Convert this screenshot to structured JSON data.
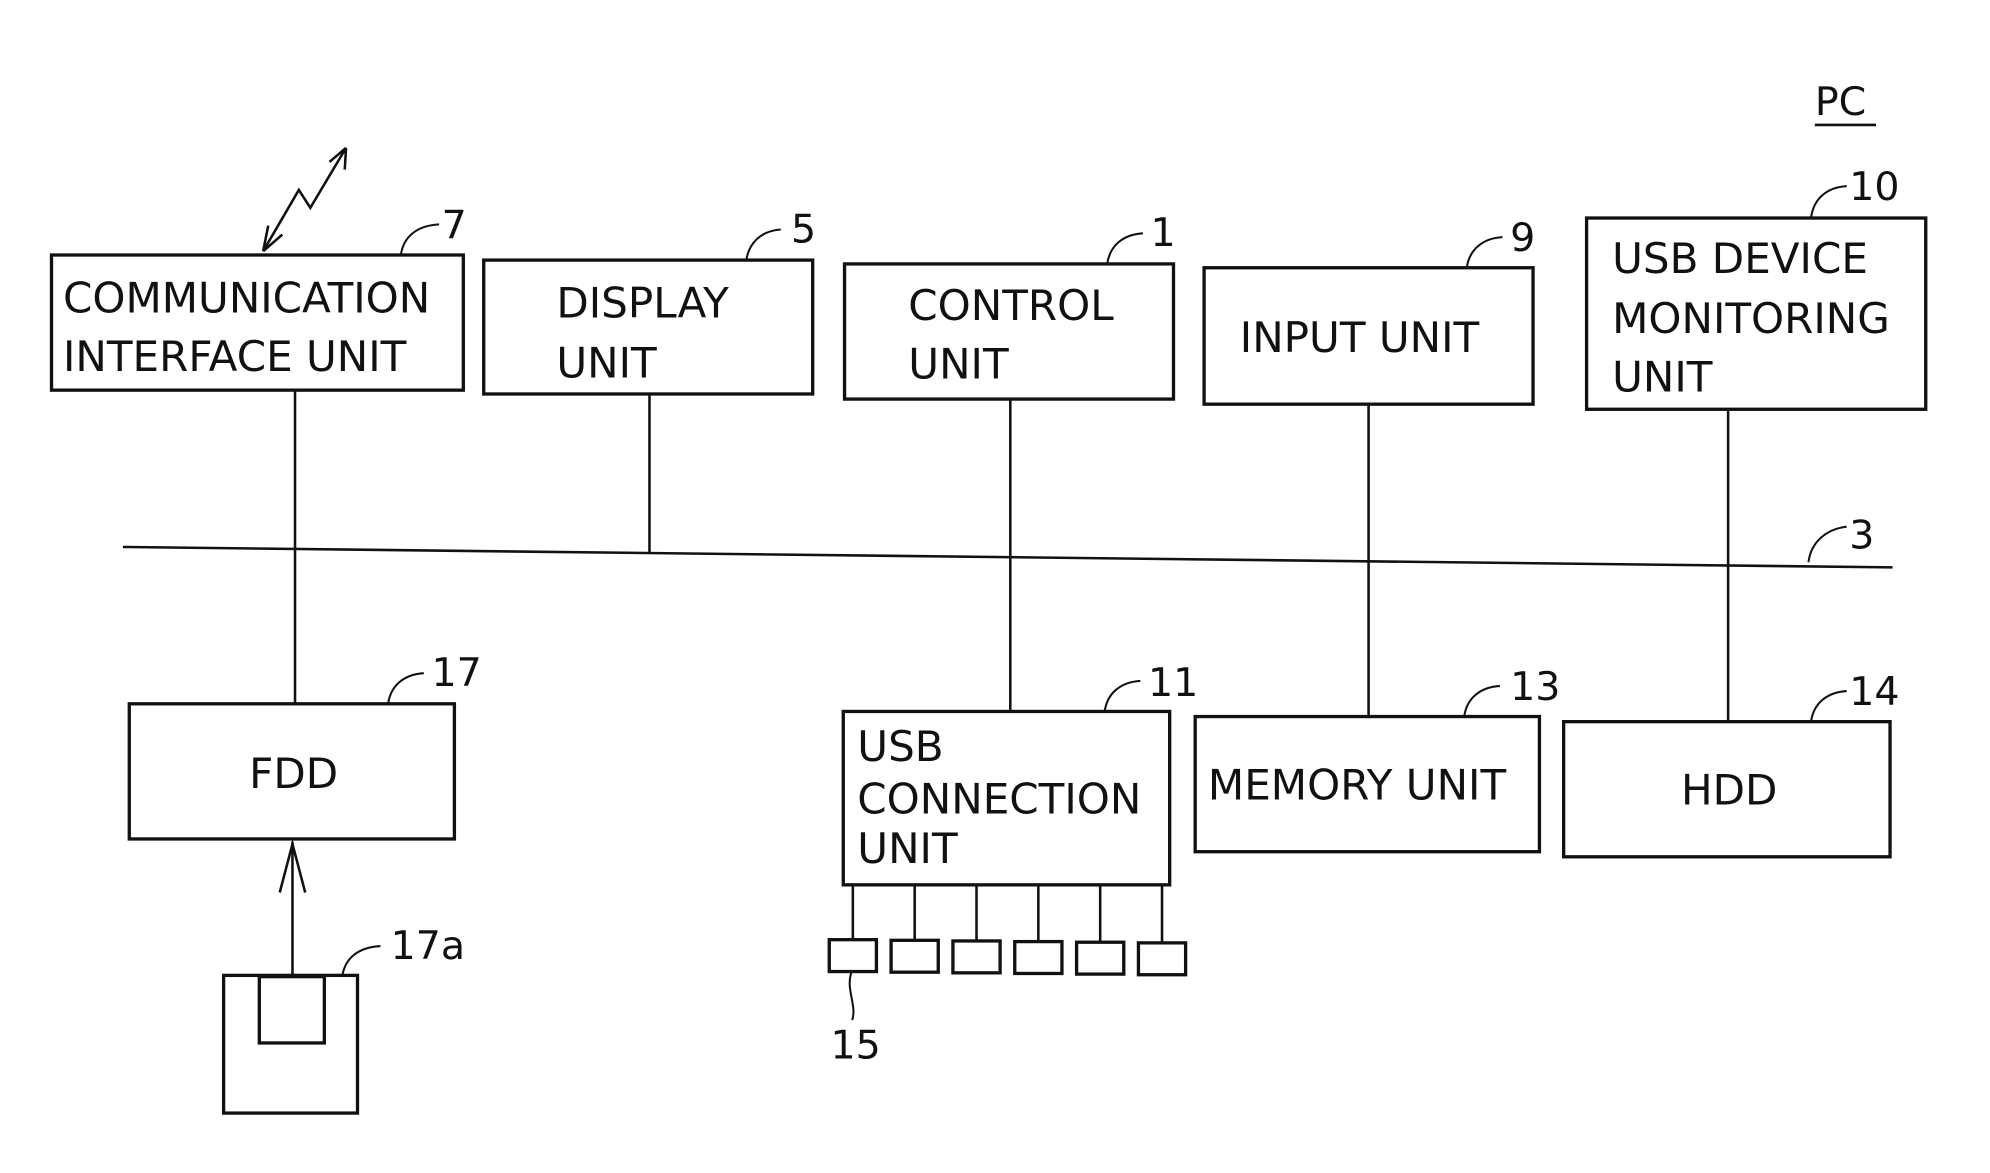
{
  "figure": {
    "label": "PC",
    "bus_ref": "3"
  },
  "blocks": {
    "comm": {
      "lines": [
        "COMMUNICATION",
        "INTERFACE UNIT"
      ],
      "ref": "7"
    },
    "display": {
      "lines": [
        "DISPLAY",
        "UNIT"
      ],
      "ref": "5"
    },
    "control": {
      "lines": [
        "CONTROL",
        "UNIT"
      ],
      "ref": "1"
    },
    "input": {
      "lines": [
        "INPUT UNIT"
      ],
      "ref": "9"
    },
    "usbmon": {
      "lines": [
        "USB DEVICE",
        "MONITORING",
        "UNIT"
      ],
      "ref": "10"
    },
    "fdd": {
      "lines": [
        "FDD"
      ],
      "ref": "17"
    },
    "usbconn": {
      "lines": [
        "USB",
        "CONNECTION",
        "UNIT"
      ],
      "ref": "11"
    },
    "memory": {
      "lines": [
        "MEMORY UNIT"
      ],
      "ref": "13"
    },
    "hdd": {
      "lines": [
        "HDD"
      ],
      "ref": "14"
    }
  },
  "usb_ports": {
    "count": 6,
    "ref": "15"
  },
  "floppy_disk": {
    "ref": "17a"
  }
}
